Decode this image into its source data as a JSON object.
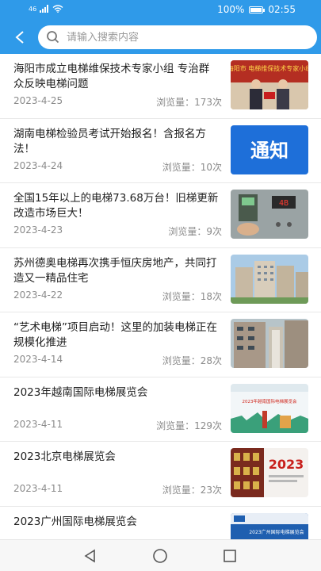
{
  "status_bar": {
    "signal": "46",
    "battery": "100%",
    "time": "02:55"
  },
  "header": {
    "search_placeholder": "请输入搜索内容"
  },
  "colors": {
    "accent": "#2f9ae9"
  },
  "views_prefix": "浏览量：",
  "news": [
    {
      "title": "海阳市成立电梯维保技术专家小组 专治群众反映电梯问题",
      "date": "2023-4-25",
      "views": "173次",
      "thumb_label": "海阳市 电梯维保技术专家小组",
      "thumb_icon": "ceremony-photo"
    },
    {
      "title": "湖南电梯检验员考试开始报名！含报名方法！",
      "date": "2023-4-24",
      "views": "10次",
      "thumb_label": "通知",
      "thumb_icon": "notice-banner"
    },
    {
      "title": "全国15年以上的电梯73.68万台！旧梯更新改造市场巨大！",
      "date": "2023-4-23",
      "views": "9次",
      "thumb_label": "4B",
      "thumb_icon": "elevator-panel-photo"
    },
    {
      "title": "苏州德奥电梯再次携手恒庆房地产，共同打造又一精品住宅",
      "date": "2023-4-22",
      "views": "18次",
      "thumb_label": "",
      "thumb_icon": "building-photo"
    },
    {
      "title": "“艺术电梯”项目启动！这里的加装电梯正在规模化推进",
      "date": "2023-4-14",
      "views": "28次",
      "thumb_label": "",
      "thumb_icon": "residential-photo"
    },
    {
      "title": "2023年越南国际电梯展览会",
      "date": "2023-4-11",
      "views": "129次",
      "thumb_label": "2023年越南国际电梯展览会",
      "thumb_icon": "expo-poster"
    },
    {
      "title": "2023北京电梯展览会",
      "date": "2023-4-11",
      "views": "23次",
      "thumb_label": "2023",
      "thumb_icon": "expo-poster"
    },
    {
      "title": "2023广州国际电梯展览会",
      "date": "",
      "views": "",
      "thumb_label": "2023广州国际电梯展览会",
      "thumb_icon": "expo-poster"
    }
  ]
}
